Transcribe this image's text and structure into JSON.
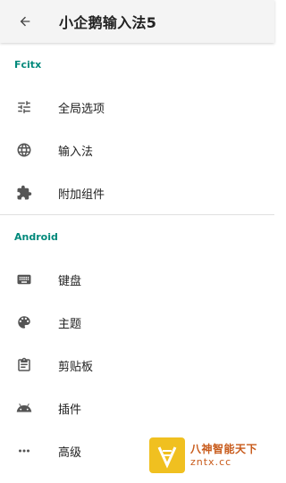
{
  "header": {
    "title": "小企鹅输入法5",
    "back_icon": "arrow-back-icon"
  },
  "sections": [
    {
      "title": "Fcitx",
      "items": [
        {
          "label": "全局选项",
          "icon": "tune-icon"
        },
        {
          "label": "输入法",
          "icon": "globe-icon"
        },
        {
          "label": "附加组件",
          "icon": "extension-icon"
        }
      ]
    },
    {
      "title": "Android",
      "items": [
        {
          "label": "键盘",
          "icon": "keyboard-icon"
        },
        {
          "label": "主题",
          "icon": "palette-icon"
        },
        {
          "label": "剪贴板",
          "icon": "clipboard-icon"
        },
        {
          "label": "插件",
          "icon": "android-icon"
        },
        {
          "label": "高级",
          "icon": "more-horiz-icon"
        }
      ]
    }
  ],
  "watermark": {
    "name": "八神智能天下",
    "url": "zntx.cc"
  },
  "colors": {
    "accent": "#00897b",
    "appbar_bg": "#f4f4f4",
    "icon": "#555555"
  }
}
